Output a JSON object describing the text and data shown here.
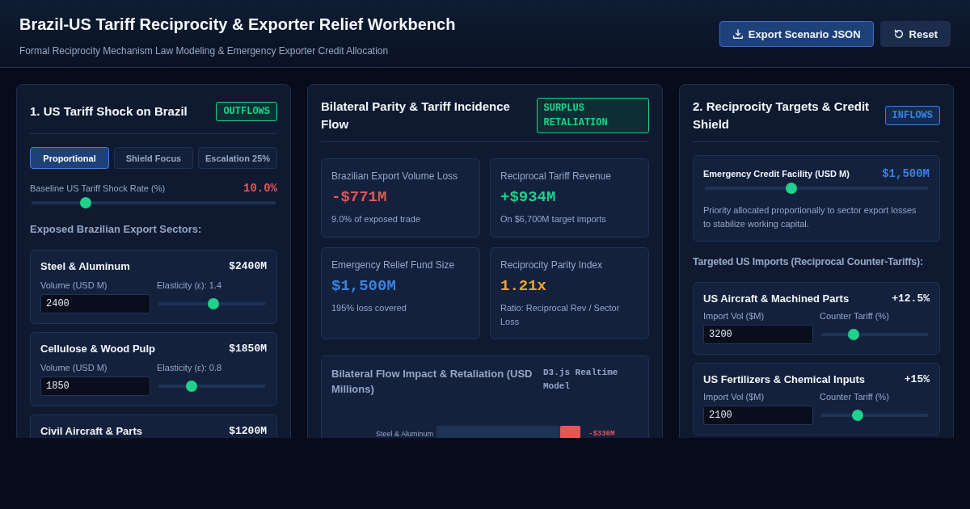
{
  "header": {
    "title": "Brazil-US Tariff Reciprocity & Exporter Relief Workbench",
    "subtitle": "Formal Reciprocity Mechanism Law Modeling & Emergency Exporter Credit Allocation",
    "buttons": [
      {
        "label": "Export Scenario JSON",
        "kind": "export"
      },
      {
        "label": "Reset",
        "kind": "reset"
      }
    ]
  },
  "left_panel": {
    "title": "1. US Tariff Shock on Brazil",
    "badge": "OUTFLOWS",
    "tabs": [
      {
        "label": "Proportional",
        "selected": true
      },
      {
        "label": "Shield Focus",
        "selected": false
      },
      {
        "label": "Escalation 25%",
        "selected": false
      }
    ],
    "shock_rate": {
      "label": "Baseline US Tariff Shock Rate (%)",
      "reading": "10.0%",
      "level": 0.21
    },
    "section_label": "Exposed Brazilian Export Sectors:",
    "sectors": [
      {
        "name": "Steel & Aluminum",
        "value": "$2400M",
        "volume_label": "Volume (USD M)",
        "volume": "2400",
        "elasticity_label": "Elasticity (ε): 1.4",
        "level": 0.52
      },
      {
        "name": "Cellulose & Wood Pulp",
        "value": "$1850M",
        "volume_label": "Volume (USD M)",
        "volume": "1850",
        "elasticity_label": "Elasticity (ε): 0.8",
        "level": 0.29
      },
      {
        "name": "Civil Aircraft & Parts",
        "value": "$1200M"
      }
    ]
  },
  "middle_panel": {
    "title": "Bilateral Parity & Tariff Incidence Flow",
    "badge": "SURPLUS RETALIATION",
    "metrics": [
      {
        "label": "Brazilian Export Volume Loss",
        "value": "-$771M",
        "note": "9.0% of exposed trade",
        "color": "#e85555"
      },
      {
        "label": "Reciprocal Tariff Revenue",
        "value": "+$934M",
        "note": "On $6,700M target imports",
        "color": "#1fd18a"
      },
      {
        "label": "Emergency Relief Fund Size",
        "value": "$1,500M",
        "note": "195% loss covered",
        "color": "#3b82e0"
      },
      {
        "label": "Reciprocity Parity Index",
        "value": "1.21x",
        "note": "Ratio: Reciprocal Rev / Sector Loss",
        "color": "#f0a526"
      }
    ],
    "flow_chart": {
      "title": "Bilateral Flow Impact & Retaliation (USD Millions)",
      "tag": "D3.js Realtime Model",
      "rows": [
        {
          "label": "Steel & Aluminum",
          "value_label": "-$336M"
        }
      ]
    }
  },
  "right_panel": {
    "title": "2. Reciprocity Targets & Credit Shield",
    "badge": "INFLOWS",
    "credit": {
      "label": "Emergency Credit Facility (USD M)",
      "reading": "$1,500M",
      "level": 0.38,
      "note": "Priority allocated proportionally to sector export losses to stabilize working capital."
    },
    "section_label": "Targeted US Imports (Reciprocal Counter-Tariffs):",
    "imports": [
      {
        "name": "US Aircraft & Machined Parts",
        "value": "+12.5%",
        "volume_label": "Import Vol ($M)",
        "volume": "3200",
        "tariff_label": "Counter Tariff (%)",
        "level": 0.28
      },
      {
        "name": "US Fertilizers & Chemical Inputs",
        "value": "+15%",
        "volume_label": "Import Vol ($M)",
        "volume": "2100",
        "tariff_label": "Counter Tariff (%)",
        "level": 0.32
      }
    ]
  }
}
